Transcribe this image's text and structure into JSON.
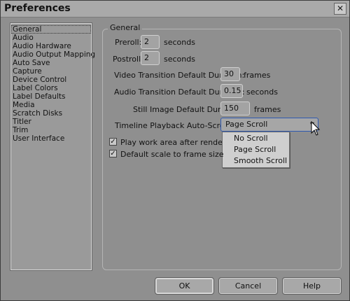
{
  "window": {
    "title": "Preferences"
  },
  "categories": [
    "General",
    "Audio",
    "Audio Hardware",
    "Audio Output Mapping",
    "Auto Save",
    "Capture",
    "Device Control",
    "Label Colors",
    "Label Defaults",
    "Media",
    "Scratch Disks",
    "Titler",
    "Trim",
    "User Interface"
  ],
  "general": {
    "group_title": "General",
    "preroll": {
      "label": "Preroll:",
      "value": "2",
      "unit": "seconds"
    },
    "postroll": {
      "label": "Postroll:",
      "value": "2",
      "unit": "seconds"
    },
    "video_transition": {
      "label": "Video Transition Default Duration:",
      "value": "30",
      "unit": "frames"
    },
    "audio_transition": {
      "label": "Audio Transition Default Duration:",
      "value": "0.15",
      "unit": "seconds"
    },
    "still_image": {
      "label": "Still Image Default Duration:",
      "value": "150",
      "unit": "frames"
    },
    "auto_scroll": {
      "label": "Timeline Playback Auto-Scrolling:",
      "selected": "Page Scroll",
      "options": [
        "No Scroll",
        "Page Scroll",
        "Smooth Scroll"
      ]
    },
    "play_work_area": {
      "label": "Play work area after rendering pre",
      "checked": true
    },
    "default_scale": {
      "label": "Default scale to frame size",
      "checked": true
    }
  },
  "buttons": {
    "ok": "OK",
    "cancel": "Cancel",
    "help": "Help"
  },
  "icons": {
    "close": "close-icon",
    "dropdown": "chevron-down-icon",
    "cursor": "mouse-pointer-icon"
  }
}
